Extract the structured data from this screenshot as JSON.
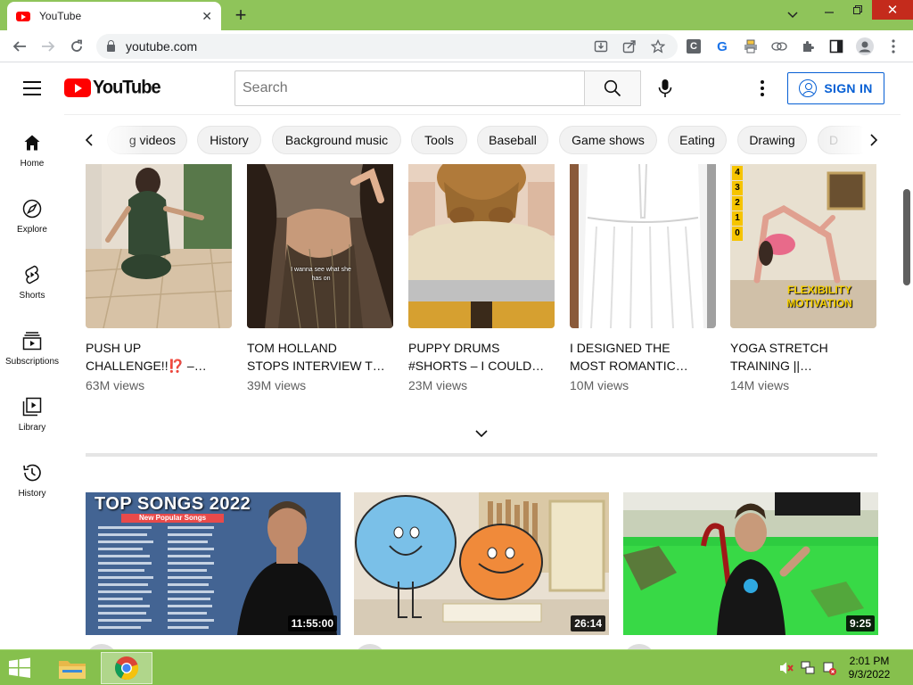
{
  "browser": {
    "tab_title": "YouTube",
    "url": "youtube.com"
  },
  "header": {
    "logo_text": "YouTube",
    "search_placeholder": "Search",
    "signin_label": "SIGN IN"
  },
  "chips": [
    "g videos",
    "History",
    "Background music",
    "Tools",
    "Baseball",
    "Game shows",
    "Eating",
    "Drawing",
    "D"
  ],
  "guide": [
    {
      "label": "Home",
      "icon": "home-icon"
    },
    {
      "label": "Explore",
      "icon": "compass-icon"
    },
    {
      "label": "Shorts",
      "icon": "shorts-icon"
    },
    {
      "label": "Subscriptions",
      "icon": "subscriptions-icon"
    },
    {
      "label": "Library",
      "icon": "library-icon"
    },
    {
      "label": "History",
      "icon": "history-icon"
    }
  ],
  "shorts": [
    {
      "title": "PUSH UP CHALLENGE!!⁉️ –…",
      "title_line1": "PUSH UP",
      "title_line2": "CHALLENGE!!⁉️ –…",
      "views": "63M views"
    },
    {
      "title": "TOM HOLLAND STOPS INTERVIEW T…",
      "title_line1": "TOM HOLLAND",
      "title_line2": "STOPS INTERVIEW T…",
      "views": "39M views",
      "caption": "I wanna see what she has on"
    },
    {
      "title": "PUPPY DRUMS #SHORTS – I COULD…",
      "title_line1": "PUPPY DRUMS",
      "title_line2": "#SHORTS – I COULD…",
      "views": "23M views"
    },
    {
      "title": "I DESIGNED THE MOST ROMANTIC…",
      "title_line1": "I DESIGNED THE",
      "title_line2": "MOST ROMANTIC…",
      "views": "10M views"
    },
    {
      "title": "YOGA STRETCH TRAINING ||…",
      "title_line1": "YOGA STRETCH",
      "title_line2": "TRAINING ||…",
      "views": "14M views",
      "overlay_line1": "FLEXIBILITY",
      "overlay_line2": "MOTIVATION",
      "counter": [
        "4",
        "3",
        "2",
        "1",
        "0"
      ]
    }
  ],
  "videos": [
    {
      "duration": "11:55:00",
      "thumb_title": "TOP SONGS 2022",
      "thumb_subtitle": "New Popular Songs"
    },
    {
      "duration": "26:14"
    },
    {
      "duration": "9:25"
    }
  ],
  "taskbar": {
    "time": "2:01 PM",
    "date": "9/3/2022"
  },
  "colors": {
    "yt_red": "#ff0000",
    "signin_blue": "#065fd4",
    "taskbar_green": "#86c04d",
    "tabstrip_green": "#8fc45a"
  }
}
